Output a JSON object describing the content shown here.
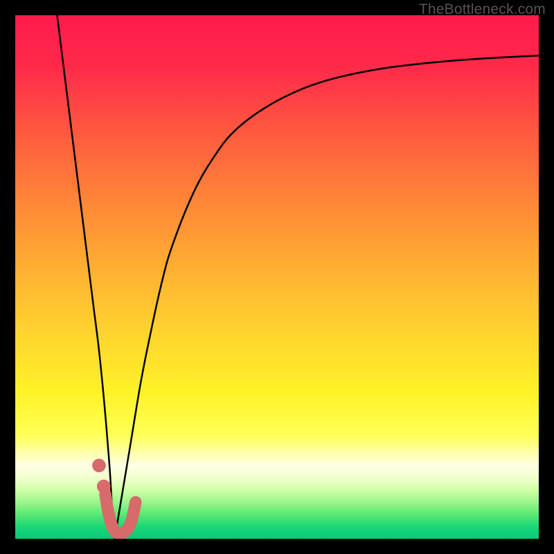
{
  "watermark": "TheBottleneck.com",
  "chart_data": {
    "type": "line",
    "title": "",
    "xlabel": "",
    "ylabel": "",
    "xlim": [
      0,
      100
    ],
    "ylim": [
      0,
      100
    ],
    "grid": false,
    "legend": false,
    "annotations": [],
    "series": [
      {
        "name": "left-branch",
        "x": [
          8,
          9,
          10,
          11,
          12,
          13,
          14,
          15,
          16,
          17,
          18,
          18.5,
          19
        ],
        "y": [
          100,
          92,
          84,
          76,
          68,
          60,
          52,
          44,
          36,
          26,
          14,
          6,
          0
        ]
      },
      {
        "name": "right-branch",
        "x": [
          19,
          20,
          22,
          24,
          26,
          28,
          30,
          34,
          38,
          42,
          48,
          55,
          62,
          70,
          78,
          86,
          94,
          100
        ],
        "y": [
          0,
          6,
          18,
          30,
          40,
          49,
          56,
          66,
          73,
          78,
          82.5,
          86,
          88.2,
          89.8,
          90.8,
          91.5,
          92,
          92.3
        ]
      },
      {
        "name": "marker-hook",
        "stroke": "#d76a6a",
        "x": [
          17.2,
          17.8,
          18.5,
          19.3,
          20.2,
          21.2,
          22.2,
          23.0
        ],
        "y": [
          8.5,
          5.0,
          2.4,
          1.2,
          1.0,
          1.6,
          3.4,
          7.0
        ]
      }
    ],
    "markers": [
      {
        "name": "dot-upper",
        "x": 16.0,
        "y": 14.0,
        "r": 1.3,
        "fill": "#d76a6a"
      },
      {
        "name": "dot-lower",
        "x": 16.9,
        "y": 10.0,
        "r": 1.3,
        "fill": "#d76a6a"
      }
    ],
    "gradient_stops": [
      {
        "offset": 0.0,
        "color": "#ff1a4d"
      },
      {
        "offset": 0.1,
        "color": "#ff2a4a"
      },
      {
        "offset": 0.22,
        "color": "#ff5840"
      },
      {
        "offset": 0.35,
        "color": "#ff8438"
      },
      {
        "offset": 0.48,
        "color": "#ffae32"
      },
      {
        "offset": 0.6,
        "color": "#ffd22f"
      },
      {
        "offset": 0.72,
        "color": "#fff227"
      },
      {
        "offset": 0.8,
        "color": "#ffff55"
      },
      {
        "offset": 0.835,
        "color": "#ffffa8"
      },
      {
        "offset": 0.86,
        "color": "#ffffe6"
      },
      {
        "offset": 0.88,
        "color": "#f4ffd0"
      },
      {
        "offset": 0.905,
        "color": "#d3ffab"
      },
      {
        "offset": 0.93,
        "color": "#9cf58c"
      },
      {
        "offset": 0.955,
        "color": "#55e874"
      },
      {
        "offset": 0.975,
        "color": "#1fd874"
      },
      {
        "offset": 1.0,
        "color": "#06c97a"
      }
    ]
  }
}
